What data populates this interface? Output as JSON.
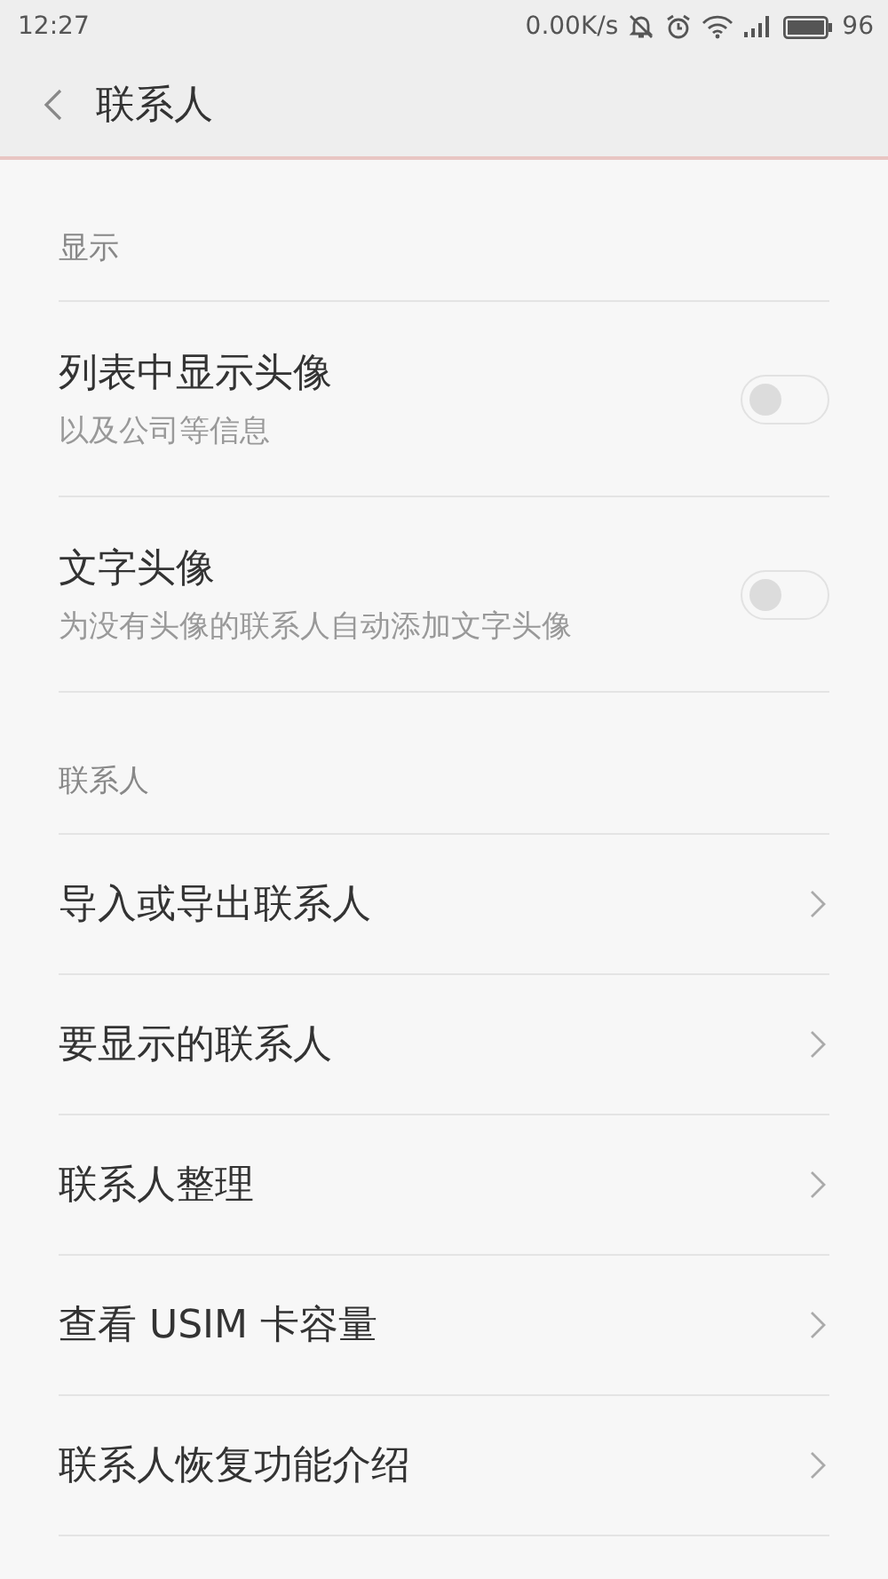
{
  "status_bar": {
    "time": "12:27",
    "speed": "0.00K/s",
    "battery": "96"
  },
  "header": {
    "title": "联系人"
  },
  "sections": [
    {
      "title": "显示",
      "items": [
        {
          "kind": "toggle",
          "label": "列表中显示头像",
          "subtitle": "以及公司等信息",
          "on": false
        },
        {
          "kind": "toggle",
          "label": "文字头像",
          "subtitle": "为没有头像的联系人自动添加文字头像",
          "on": false
        }
      ]
    },
    {
      "title": "联系人",
      "items": [
        {
          "kind": "link",
          "label": "导入或导出联系人"
        },
        {
          "kind": "link",
          "label": "要显示的联系人"
        },
        {
          "kind": "link",
          "label": "联系人整理"
        },
        {
          "kind": "link",
          "label": "查看 USIM 卡容量"
        },
        {
          "kind": "link",
          "label": "联系人恢复功能介绍"
        }
      ]
    }
  ]
}
